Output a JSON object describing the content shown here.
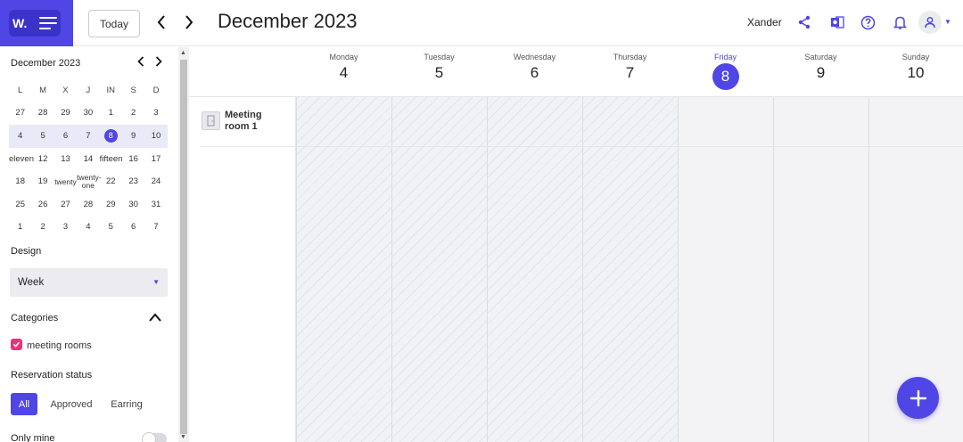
{
  "header": {
    "logo_text": "W.",
    "today_label": "Today",
    "month_title": "December 2023",
    "user_name": "Xander",
    "accent": "#4f46e5",
    "icons": [
      "menu-icon",
      "chevron-left-icon",
      "chevron-right-icon",
      "share-icon",
      "office-icon",
      "help-icon",
      "bell-icon",
      "user-icon",
      "caret-down-icon"
    ]
  },
  "mini_calendar": {
    "title": "December 2023",
    "weekdays": [
      "L",
      "M",
      "X",
      "J",
      "IN",
      "S",
      "D"
    ],
    "weeks": [
      [
        "27",
        "28",
        "29",
        "30",
        "1",
        "2",
        "3"
      ],
      [
        "4",
        "5",
        "6",
        "7",
        "8",
        "9",
        "10"
      ],
      [
        "eleven",
        "12",
        "13",
        "14",
        "fifteen",
        "16",
        "17"
      ],
      [
        "18",
        "19",
        "twenty",
        "twenty-one",
        "22",
        "23",
        "24"
      ],
      [
        "25",
        "26",
        "27",
        "28",
        "29",
        "30",
        "31"
      ],
      [
        "1",
        "2",
        "3",
        "4",
        "5",
        "6",
        "7"
      ]
    ],
    "selected": "8"
  },
  "sidebar": {
    "design_label": "Design",
    "design_value": "Week",
    "categories_label": "Categories",
    "category_item": "meeting rooms",
    "status_label": "Reservation status",
    "status_options": [
      "All",
      "Approved",
      "Earring"
    ],
    "status_selected": "All",
    "only_mine_label": "Only mine"
  },
  "week": {
    "days": [
      {
        "name": "Monday",
        "num": "4",
        "today": false,
        "past": true
      },
      {
        "name": "Tuesday",
        "num": "5",
        "today": false,
        "past": true
      },
      {
        "name": "Wednesday",
        "num": "6",
        "today": false,
        "past": true
      },
      {
        "name": "Thursday",
        "num": "7",
        "today": false,
        "past": true
      },
      {
        "name": "Friday",
        "num": "8",
        "today": true,
        "past": false
      },
      {
        "name": "Saturday",
        "num": "9",
        "today": false,
        "past": false
      },
      {
        "name": "Sunday",
        "num": "10",
        "today": false,
        "past": false
      }
    ],
    "resource": "Meeting room 1"
  },
  "fab_label": "+"
}
